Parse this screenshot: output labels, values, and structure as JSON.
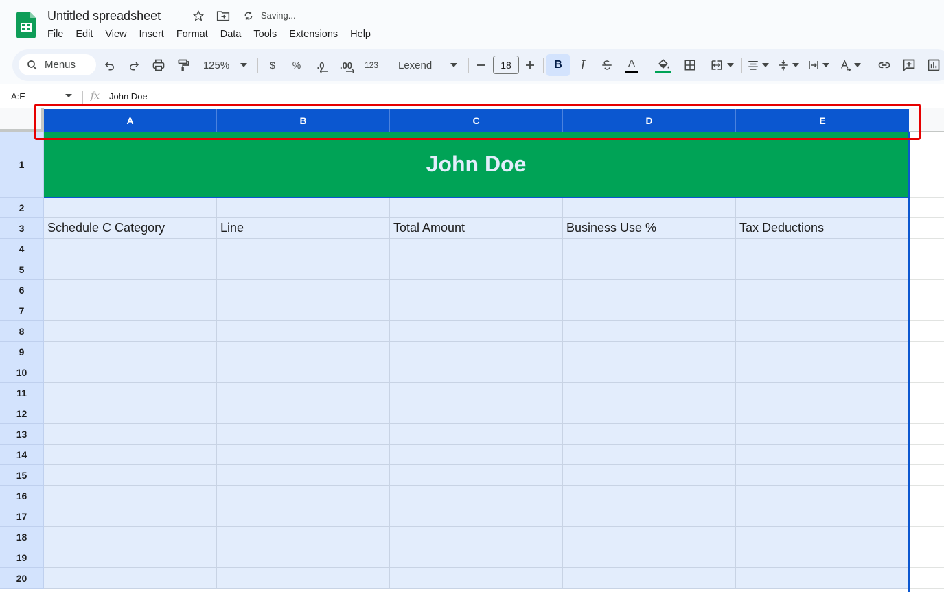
{
  "app": {
    "title": "Untitled spreadsheet",
    "status": "Saving...",
    "menu": [
      "File",
      "Edit",
      "View",
      "Insert",
      "Format",
      "Data",
      "Tools",
      "Extensions",
      "Help"
    ]
  },
  "toolbar": {
    "search_label": "Menus",
    "zoom": "125%",
    "currency": "$",
    "percent": "%",
    "decrease_decimal": ".0",
    "increase_decimal": ".00",
    "number_format": "123",
    "font": "Lexend",
    "font_size": "18",
    "bold": "B",
    "italic": "I",
    "text_color": "A"
  },
  "formula_bar": {
    "name_box": "A:E",
    "fx": "fx",
    "value": "John Doe"
  },
  "grid": {
    "columns": [
      "A",
      "B",
      "C",
      "D",
      "E"
    ],
    "rows": [
      "1",
      "2",
      "3",
      "4",
      "5",
      "6",
      "7",
      "8",
      "9",
      "10",
      "11",
      "12",
      "13",
      "14",
      "15",
      "16",
      "17",
      "18",
      "19",
      "20"
    ],
    "title_cell": "John Doe",
    "header_row": [
      "Schedule C Category",
      "Line",
      "Total Amount",
      "Business Use %",
      "Tax Deductions"
    ]
  },
  "colors": {
    "accent": "#0b57d0",
    "title_fill": "#00a356",
    "cell_fill": "#e3edfc",
    "highlight": "#e60000"
  }
}
